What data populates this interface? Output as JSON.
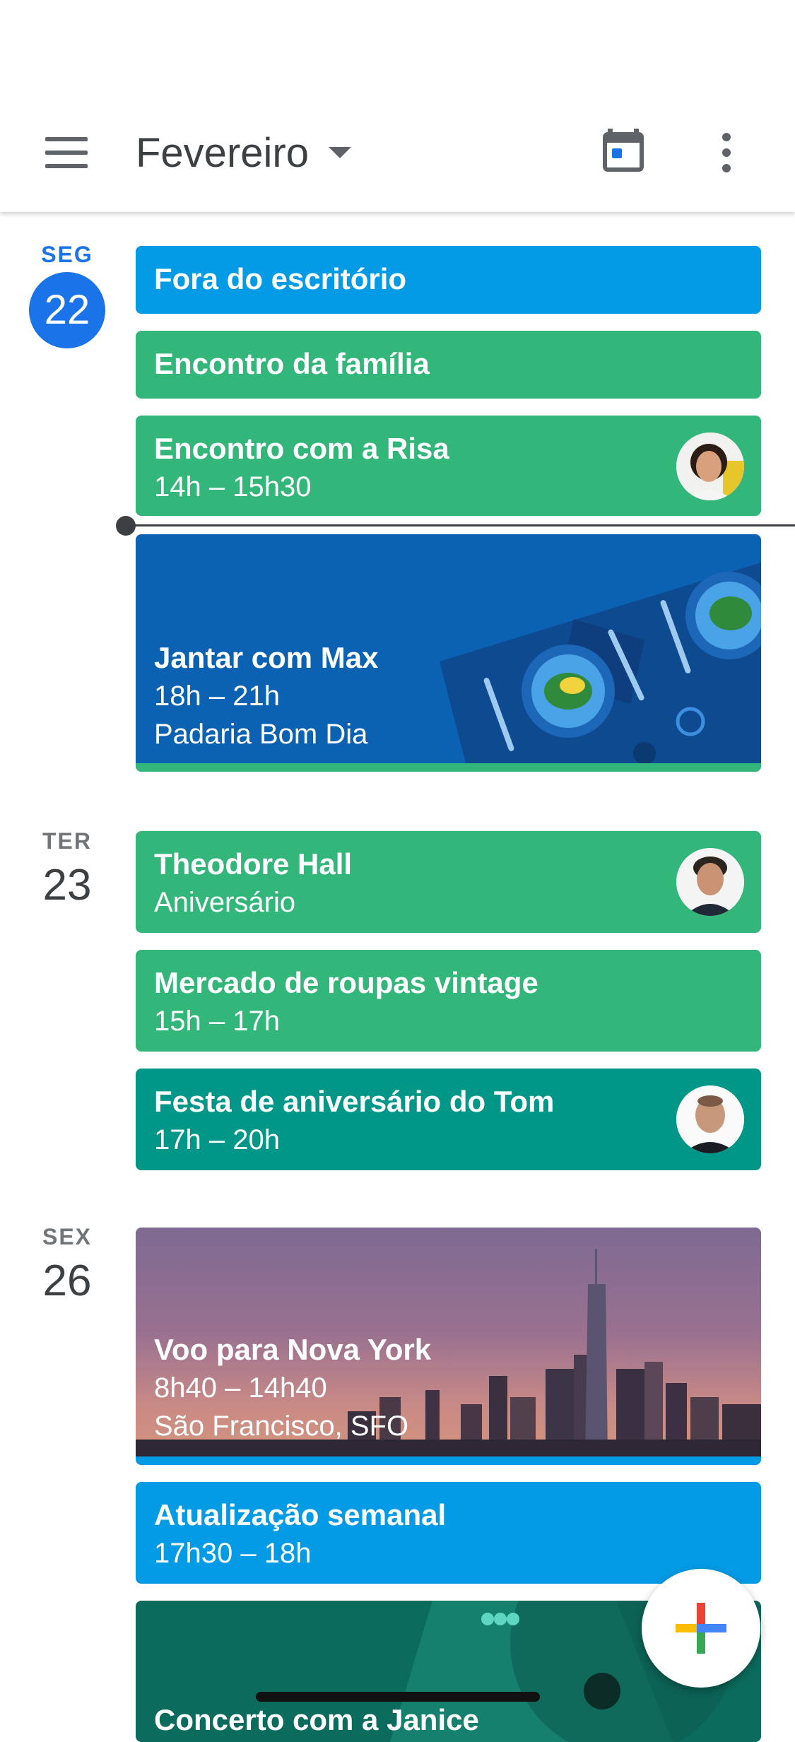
{
  "header": {
    "month": "Fevereiro",
    "menu_icon": "hamburger-menu-icon",
    "today_icon": "calendar-today-icon",
    "more_icon": "more-vertical-icon"
  },
  "days": [
    {
      "dow": "SEG",
      "num": "22",
      "today": true,
      "events": [
        {
          "title": "Fora do escritório",
          "color": "#039be5"
        },
        {
          "title": "Encontro da família",
          "color": "#33b679"
        },
        {
          "title": "Encontro com a Risa",
          "time": "14h – 15h30",
          "color": "#33b679",
          "avatar": "person-avatar"
        },
        {
          "title": "Jantar com Max",
          "time": "18h – 21h",
          "location": "Padaria Bom Dia",
          "color": "#0b62b3",
          "bottom_bar": "#33b679"
        }
      ]
    },
    {
      "dow": "TER",
      "num": "23",
      "today": false,
      "events": [
        {
          "title": "Theodore Hall",
          "subtitle": "Aniversário",
          "color": "#33b679",
          "avatar": "person-avatar"
        },
        {
          "title": "Mercado de roupas vintage",
          "time": "15h – 17h",
          "color": "#33b679"
        },
        {
          "title": "Festa de aniversário do Tom",
          "time": "17h – 20h",
          "color": "#009688",
          "avatar": "person-avatar"
        }
      ]
    },
    {
      "dow": "SEX",
      "num": "26",
      "today": false,
      "events": [
        {
          "title": "Voo para Nova York",
          "time": "8h40 – 14h40",
          "location": "São Francisco, SFO",
          "color": "#6e5a7e",
          "bottom_bar": "#039be5"
        },
        {
          "title": "Atualização semanal",
          "time": "17h30 – 18h",
          "color": "#039be5"
        },
        {
          "title": "Concerto com a Janice",
          "color": "#0b6b5c"
        }
      ]
    }
  ],
  "fab": {
    "icon": "add-plus-icon",
    "colors": [
      "#ea4335",
      "#4285f4",
      "#34a853",
      "#fbbc04"
    ]
  }
}
